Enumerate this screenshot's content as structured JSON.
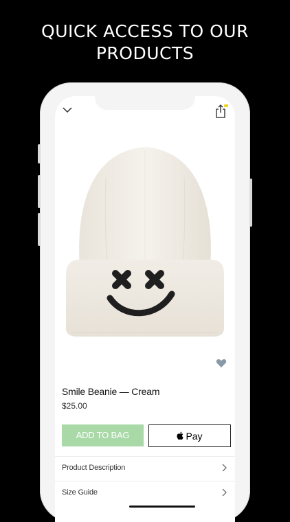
{
  "headline": {
    "line1": "QUICK ACCESS TO OUR",
    "line2": "PRODUCTS"
  },
  "nav": {
    "back_icon": "chevron-down-icon",
    "share_icon": "share-icon",
    "share_badge_color": "#f2d21a"
  },
  "product": {
    "title": "Smile Beanie — Cream",
    "price": "$25.00",
    "image_icon": "beanie-image",
    "favorite_icon": "heart-icon",
    "favorite_color": "#8a99a6"
  },
  "actions": {
    "add_to_bag": "ADD TO BAG",
    "add_to_bag_color": "#a8d9a7",
    "apple_pay_label": "Pay",
    "apple_pay_icon": "apple-icon"
  },
  "details": [
    {
      "label": "Product Description"
    },
    {
      "label": "Size Guide"
    }
  ]
}
